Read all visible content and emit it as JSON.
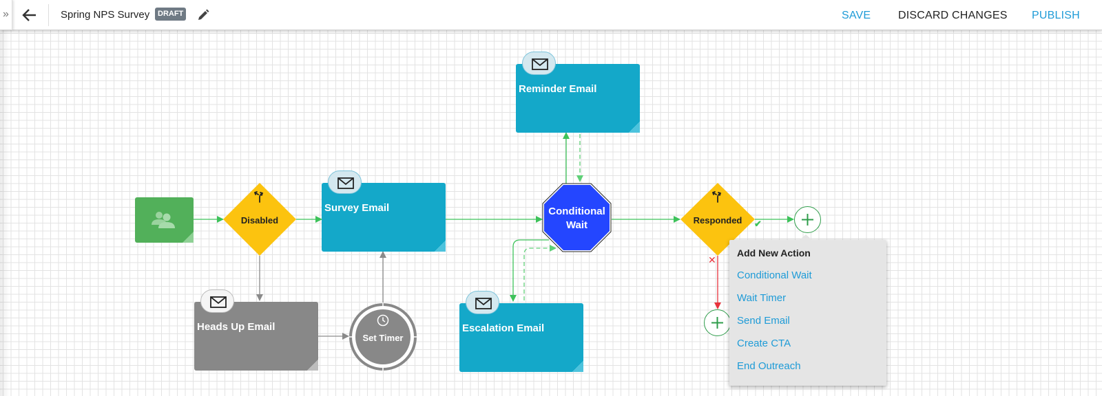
{
  "header": {
    "expand_icon": "double-chevron-right-icon",
    "back_icon": "arrow-left-icon",
    "title": "Spring NPS Survey",
    "status_badge": "DRAFT",
    "edit_icon": "pencil-icon",
    "actions": {
      "save": "SAVE",
      "discard": "DISCARD CHANGES",
      "publish": "PUBLISH"
    }
  },
  "colors": {
    "accent": "#1e9bd7",
    "email_node": "#14a8c9",
    "disabled_node": "#888888",
    "decision_node": "#fcc30f",
    "conditional_wait": "#2446ff",
    "participants_node": "#52b05a",
    "edge_positive": "#3dc25a",
    "edge_negative": "#e8333c",
    "edge_neutral": "#8a8a8a"
  },
  "flow": {
    "nodes": {
      "participants": {
        "type": "participants",
        "icon": "people-icon",
        "label": ""
      },
      "disabled": {
        "type": "decision",
        "icon": "split-arrows-icon",
        "label": "Disabled"
      },
      "survey_email": {
        "type": "email",
        "icon": "envelope-icon",
        "label": "Survey Email"
      },
      "heads_up_email": {
        "type": "email-disabled",
        "icon": "envelope-icon",
        "label": "Heads Up Email"
      },
      "set_timer": {
        "type": "timer",
        "icon": "clock-icon",
        "label": "Set Timer"
      },
      "conditional_wait": {
        "type": "conditional-wait",
        "label_line1": "Conditional",
        "label_line2": "Wait"
      },
      "reminder_email": {
        "type": "email",
        "icon": "envelope-icon",
        "label": "Reminder Email"
      },
      "escalation_email": {
        "type": "email",
        "icon": "envelope-icon",
        "label": "Escalation Email"
      },
      "responded": {
        "type": "decision",
        "icon": "split-arrows-icon",
        "label": "Responded"
      },
      "add_yes": {
        "type": "add-action",
        "icon": "plus-icon"
      },
      "add_no": {
        "type": "add-action",
        "icon": "plus-icon"
      }
    },
    "branch_markers": {
      "yes": "✔",
      "no": "✕"
    }
  },
  "add_action_menu": {
    "title": "Add New Action",
    "items": [
      "Conditional Wait",
      "Wait Timer",
      "Send Email",
      "Create CTA",
      "End Outreach"
    ]
  }
}
